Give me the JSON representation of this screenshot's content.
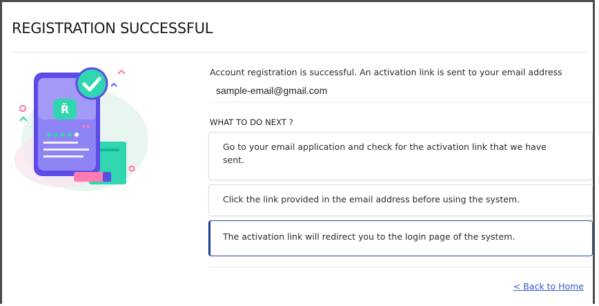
{
  "page": {
    "title": "REGISTRATION SUCCESSFUL"
  },
  "message": {
    "text": "Account registration is successful. An activation link is sent to your email address",
    "email": "sample-email@gmail.com"
  },
  "next_steps": {
    "label": "WHAT TO DO NEXT ?",
    "items": [
      {
        "text": "Go to your email application and check for the activation link that we have sent."
      },
      {
        "text": "Click the link provided in the email address before using the system."
      },
      {
        "text": "The activation link will redirect you to the login page of the system."
      }
    ]
  },
  "footer": {
    "back_link": "< Back to Home"
  },
  "illustration": {
    "icon": "phone-verification-illustration"
  },
  "colors": {
    "accent": "#1c3a94",
    "link": "#2f55c9",
    "phone_purple": "#6b5cf0",
    "teal": "#2fd6b0",
    "pink": "#ff7bb0"
  }
}
